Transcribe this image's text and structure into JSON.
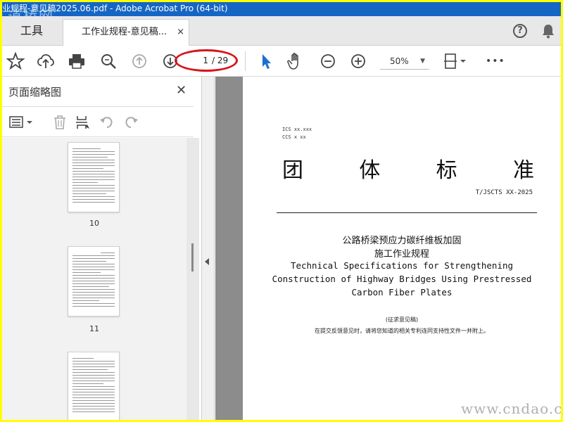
{
  "window": {
    "title": "业规程-意见稿2025.06.pdf - Adobe Acrobat Pro (64-bit)"
  },
  "watermarks": {
    "top_left": "道桥网",
    "bottom_right": "www.cndao.com"
  },
  "tabs": {
    "tools_label": "工具",
    "document_label": "工作业规程-意见稿...",
    "close_glyph": "×"
  },
  "header_icons": {
    "help": "?",
    "help_icon": "help-icon",
    "bell_icon": "bell-icon"
  },
  "toolbar": {
    "page_current": "1",
    "page_total": "/ 29",
    "zoom": "50%",
    "icons": [
      "star-icon",
      "upload-icon",
      "print-icon",
      "zoom-search-icon",
      "page-up-icon",
      "page-down-icon",
      "select-arrow-icon",
      "hand-icon",
      "zoom-out-icon",
      "zoom-in-icon",
      "fit-page-icon",
      "more-icon"
    ],
    "more_glyph": "•••",
    "highlight_color": "#d9141b"
  },
  "thumbnail_panel": {
    "title": "页面缩略图",
    "close_glyph": "✕",
    "pages": [
      {
        "label": "10"
      },
      {
        "label": "11"
      }
    ]
  },
  "document": {
    "ics": "ICS xx.xxx",
    "ccs": "CCS x xx",
    "std_title_chars": [
      "团",
      "体",
      "标",
      "准"
    ],
    "std_number": "T/JSCTS XX-2025",
    "cn_title_line1": "公路桥梁预应力碳纤维板加固",
    "cn_title_line2": "施工作业规程",
    "en_title_line1": "Technical Specifications for Strengthening",
    "en_title_line2": "Construction of Highway Bridges Using Prestressed",
    "en_title_line3": "Carbon Fiber Plates",
    "draft_label": "(征求意见稿)",
    "note": "在提交反馈意见时，请将您知道的相关专利连同支持性文件一并附上。"
  },
  "colors": {
    "titlebar": "#1566c4",
    "frame": "#ffff00",
    "select_arrow": "#1b6fd1"
  }
}
